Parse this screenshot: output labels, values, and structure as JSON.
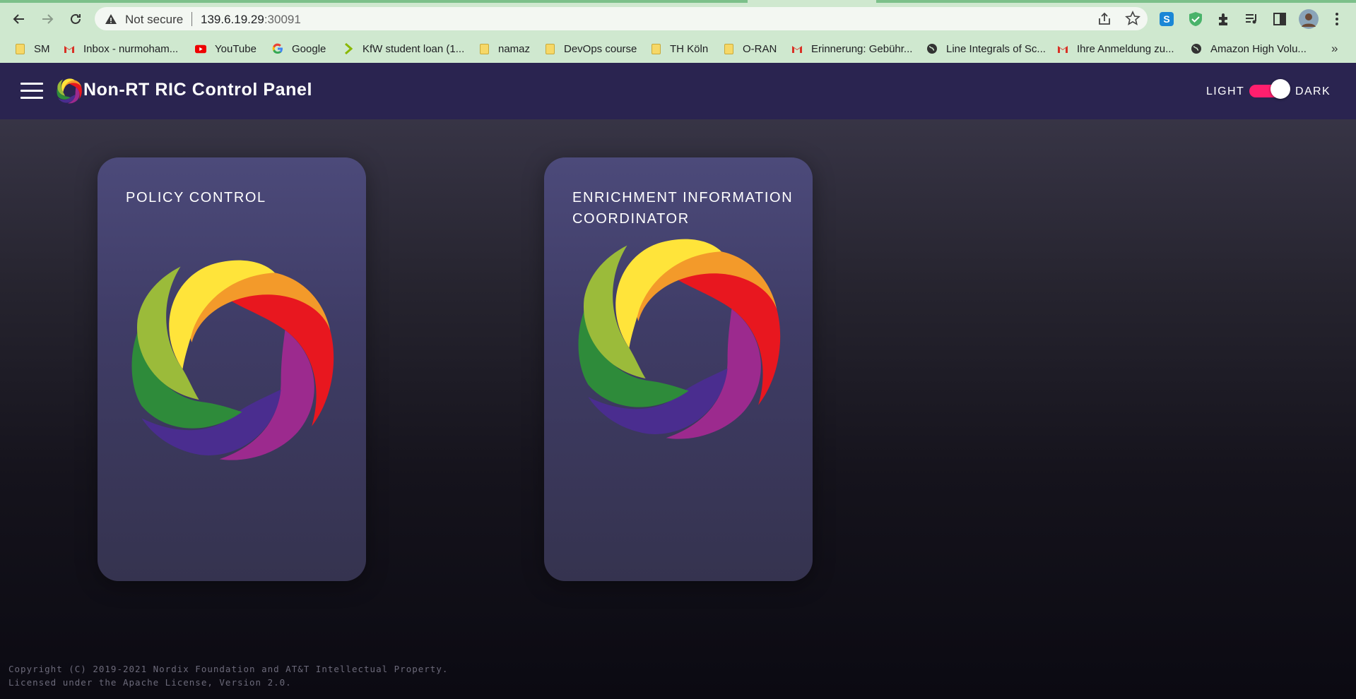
{
  "browser": {
    "security_label": "Not secure",
    "url_host": "139.6.19.29",
    "url_port": ":30091",
    "bookmarks": [
      {
        "label": "SM",
        "icon": "folder-icon"
      },
      {
        "label": "Inbox - nurmoham...",
        "icon": "gmail-icon"
      },
      {
        "label": "YouTube",
        "icon": "youtube-icon"
      },
      {
        "label": "Google",
        "icon": "google-icon"
      },
      {
        "label": "KfW student loan (1...",
        "icon": "kfw-icon"
      },
      {
        "label": "namaz",
        "icon": "folder-icon"
      },
      {
        "label": "DevOps course",
        "icon": "folder-icon"
      },
      {
        "label": "TH Köln",
        "icon": "folder-icon"
      },
      {
        "label": "O-RAN",
        "icon": "folder-icon"
      },
      {
        "label": "Erinnerung: Gebühr...",
        "icon": "gmail-icon"
      },
      {
        "label": "Line Integrals of Sc...",
        "icon": "globe-icon"
      },
      {
        "label": "Ihre Anmeldung zu...",
        "icon": "gmail-icon"
      },
      {
        "label": "Amazon High Volu...",
        "icon": "globe-icon"
      }
    ],
    "bookmarks_overflow": "»"
  },
  "app": {
    "title": "Non-RT RIC Control Panel",
    "theme": {
      "light_label": "LIGHT",
      "dark_label": "DARK",
      "dark_enabled": true,
      "accent": "#ff1f6e"
    },
    "toolbar_color": "#2a2450",
    "cards": [
      {
        "title": "POLICY CONTROL"
      },
      {
        "title": "ENRICHMENT INFORMATION COORDINATOR"
      }
    ],
    "footer": {
      "line1": "Copyright (C) 2019-2021 Nordix Foundation and AT&T Intellectual Property.",
      "line2": "Licensed under the Apache License, Version 2.0."
    }
  }
}
